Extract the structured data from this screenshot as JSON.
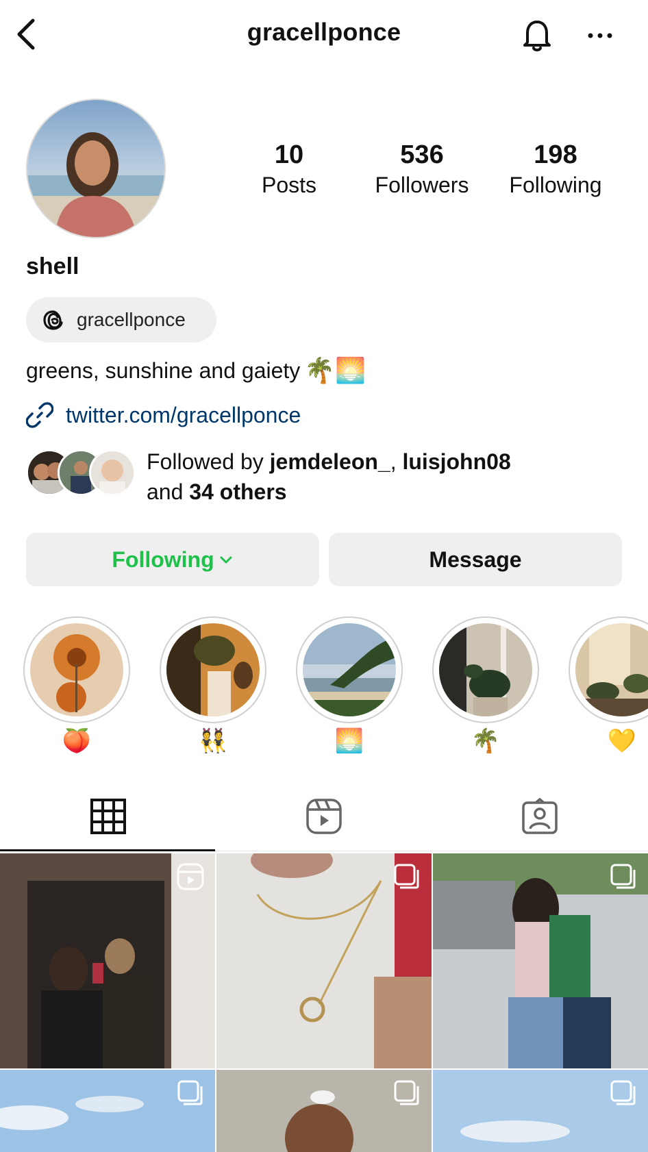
{
  "header": {
    "username": "gracellponce"
  },
  "profile": {
    "stats": [
      {
        "value": "10",
        "label": "Posts"
      },
      {
        "value": "536",
        "label": "Followers"
      },
      {
        "value": "198",
        "label": "Following"
      }
    ],
    "display_name": "shell",
    "threads_handle": "gracellponce",
    "bio": "greens, sunshine and gaiety",
    "bio_emojis": "🌴🌅",
    "link": "twitter.com/gracellponce",
    "followed_by": {
      "prefix": "Followed by ",
      "user1": "jemdeleon_",
      "separator": ", ",
      "user2": "luisjohn08",
      "and": "and ",
      "others": "34 others"
    }
  },
  "actions": {
    "following_label": "Following",
    "message_label": "Message"
  },
  "highlights": [
    {
      "emoji": "🍑"
    },
    {
      "emoji": "👯"
    },
    {
      "emoji": "🌅"
    },
    {
      "emoji": "🌴"
    },
    {
      "emoji": "💛"
    }
  ],
  "tabs": [
    "grid-icon",
    "reels-icon",
    "tagged-icon"
  ],
  "colors": {
    "accent_following": "#1fc14b",
    "link": "#00376b",
    "button_bg": "#efefef"
  }
}
